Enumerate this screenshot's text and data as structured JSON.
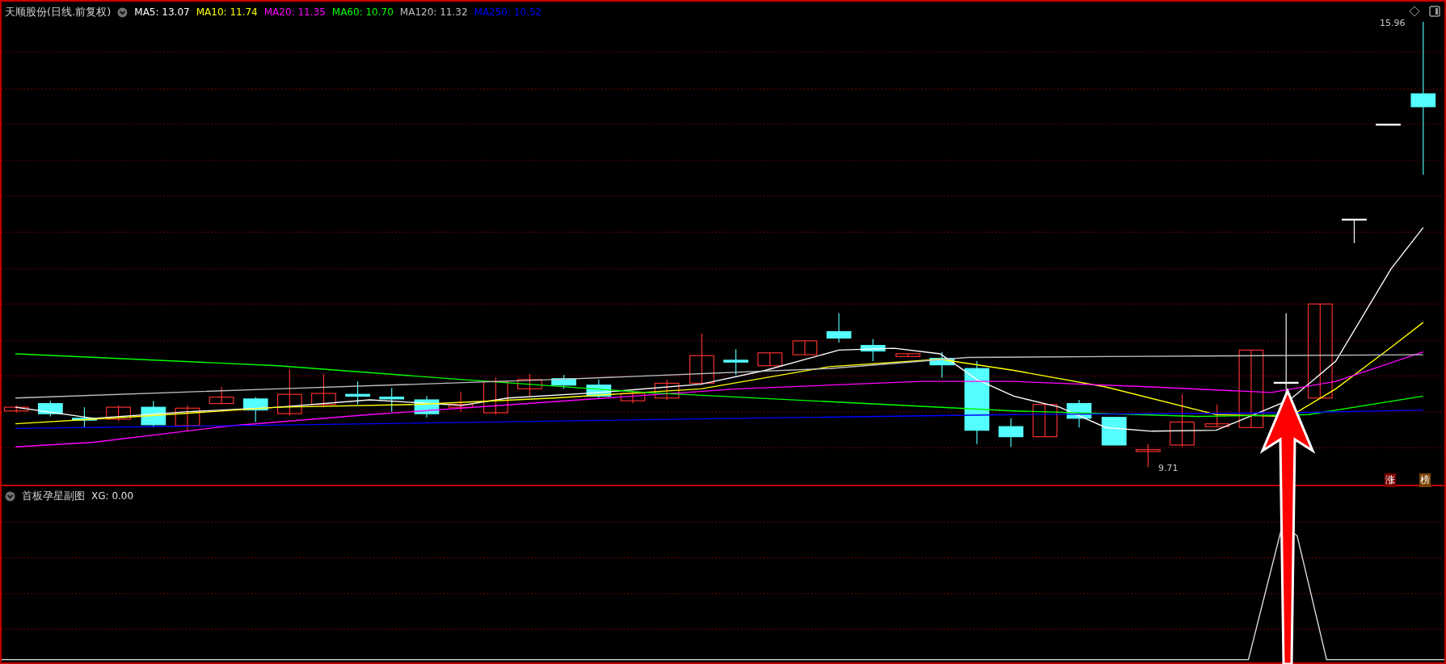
{
  "main_chart": {
    "title": "天顺股份(日线.前复权)",
    "moving_averages": [
      {
        "label": "MA5: 13.07",
        "color": "#ffffff"
      },
      {
        "label": "MA10: 11.74",
        "color": "#ffff00"
      },
      {
        "label": "MA20: 11.35",
        "color": "#ff00ff"
      },
      {
        "label": "MA60: 10.70",
        "color": "#00ff00"
      },
      {
        "label": "MA120: 11.32",
        "color": "#c0c0c0"
      },
      {
        "label": "MA250: 10.52",
        "color": "#0000ff"
      }
    ],
    "high_label": "15.96",
    "low_label": "9.71",
    "badges": [
      {
        "text": "涨",
        "color": "#7a0000"
      },
      {
        "text": "榜",
        "color": "#7a4000"
      }
    ]
  },
  "sub_chart": {
    "title": "首板孕星副图",
    "reading": "XG: 0.00"
  }
}
